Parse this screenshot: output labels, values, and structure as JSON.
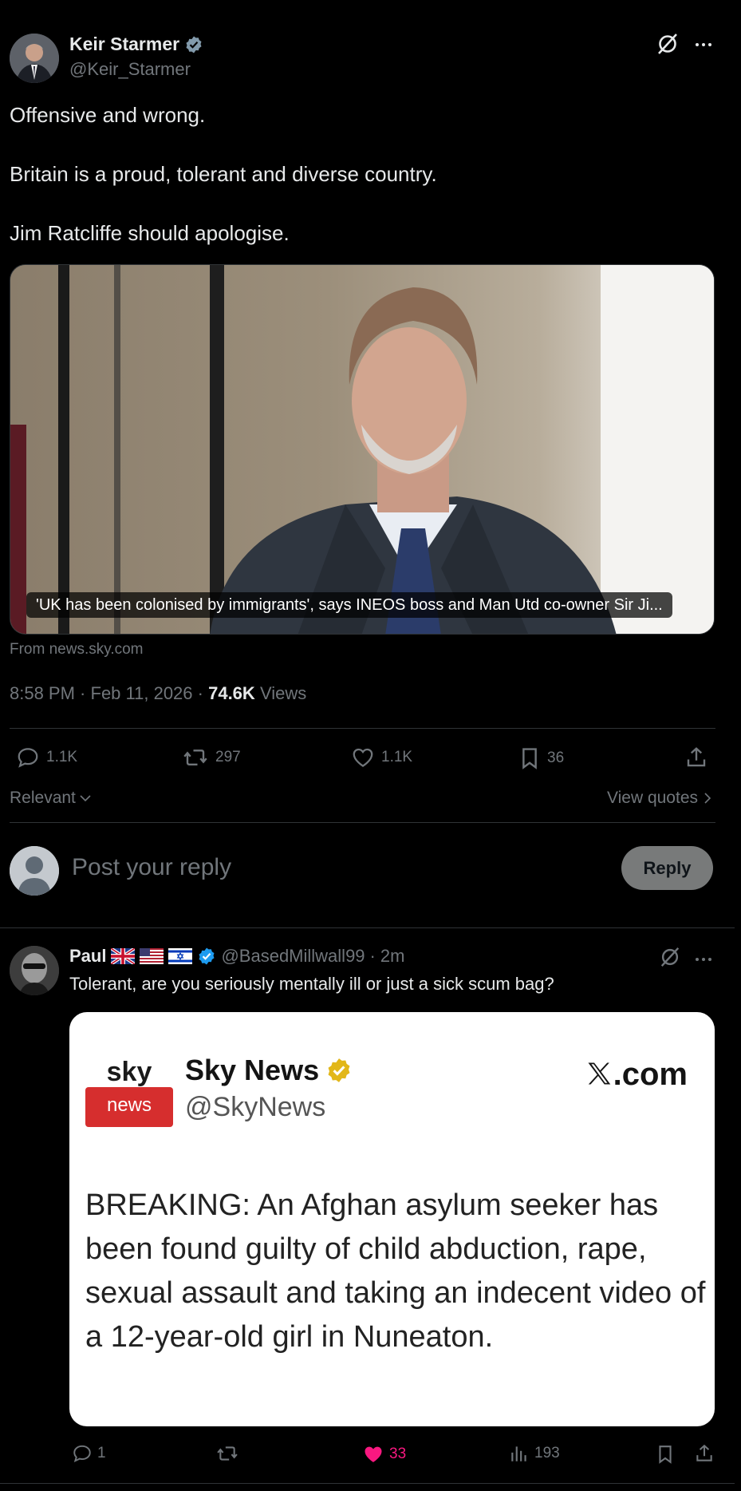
{
  "main_tweet": {
    "author_name": "Keir Starmer",
    "author_handle": "@Keir_Starmer",
    "text_lines": [
      "Offensive and wrong.",
      "Britain is a proud, tolerant and diverse country.",
      "Jim Ratcliffe should apologise."
    ],
    "card_caption": "'UK has been colonised by immigrants', says INEOS boss and Man Utd co-owner Sir Ji...",
    "card_source": "From news.sky.com",
    "time": "8:58 PM",
    "date": "Feb 11, 2026",
    "views_count": "74.6K",
    "views_label": "Views",
    "stats": {
      "replies": "1.1K",
      "reposts": "297",
      "likes": "1.1K",
      "bookmarks": "36"
    }
  },
  "sort_label": "Relevant",
  "view_quotes_label": "View quotes",
  "composer": {
    "placeholder": "Post your reply",
    "reply_button": "Reply"
  },
  "reply_tweet": {
    "author_name": "Paul",
    "author_handle": "@BasedMillwall99",
    "time_ago": "2m",
    "text": "Tolerant, are you seriously mentally ill or just a sick scum bag?",
    "stats": {
      "replies": "1",
      "likes": "33",
      "views": "193"
    },
    "like_color": "#f91880"
  },
  "embedded_image": {
    "logo_top": "sky",
    "logo_bottom": "news",
    "account_name": "Sky News",
    "account_handle": "@SkyNews",
    "brand": ".com",
    "text": "BREAKING: An Afghan asylum seeker has been found guilty of child abduction, rape, sexual assault and taking an indecent video of a 12-year-old girl in Nuneaton."
  },
  "colors": {
    "verified_blue": "#1d9bf0",
    "verified_gold": "#e2b719",
    "sky_red": "#d62e2e"
  },
  "icons": [
    "verified-badge-icon",
    "grok-icon",
    "more-icon",
    "reply-icon",
    "repost-icon",
    "like-icon",
    "bookmark-icon",
    "share-icon",
    "views-icon",
    "chevron-down-icon",
    "chevron-right-icon"
  ]
}
